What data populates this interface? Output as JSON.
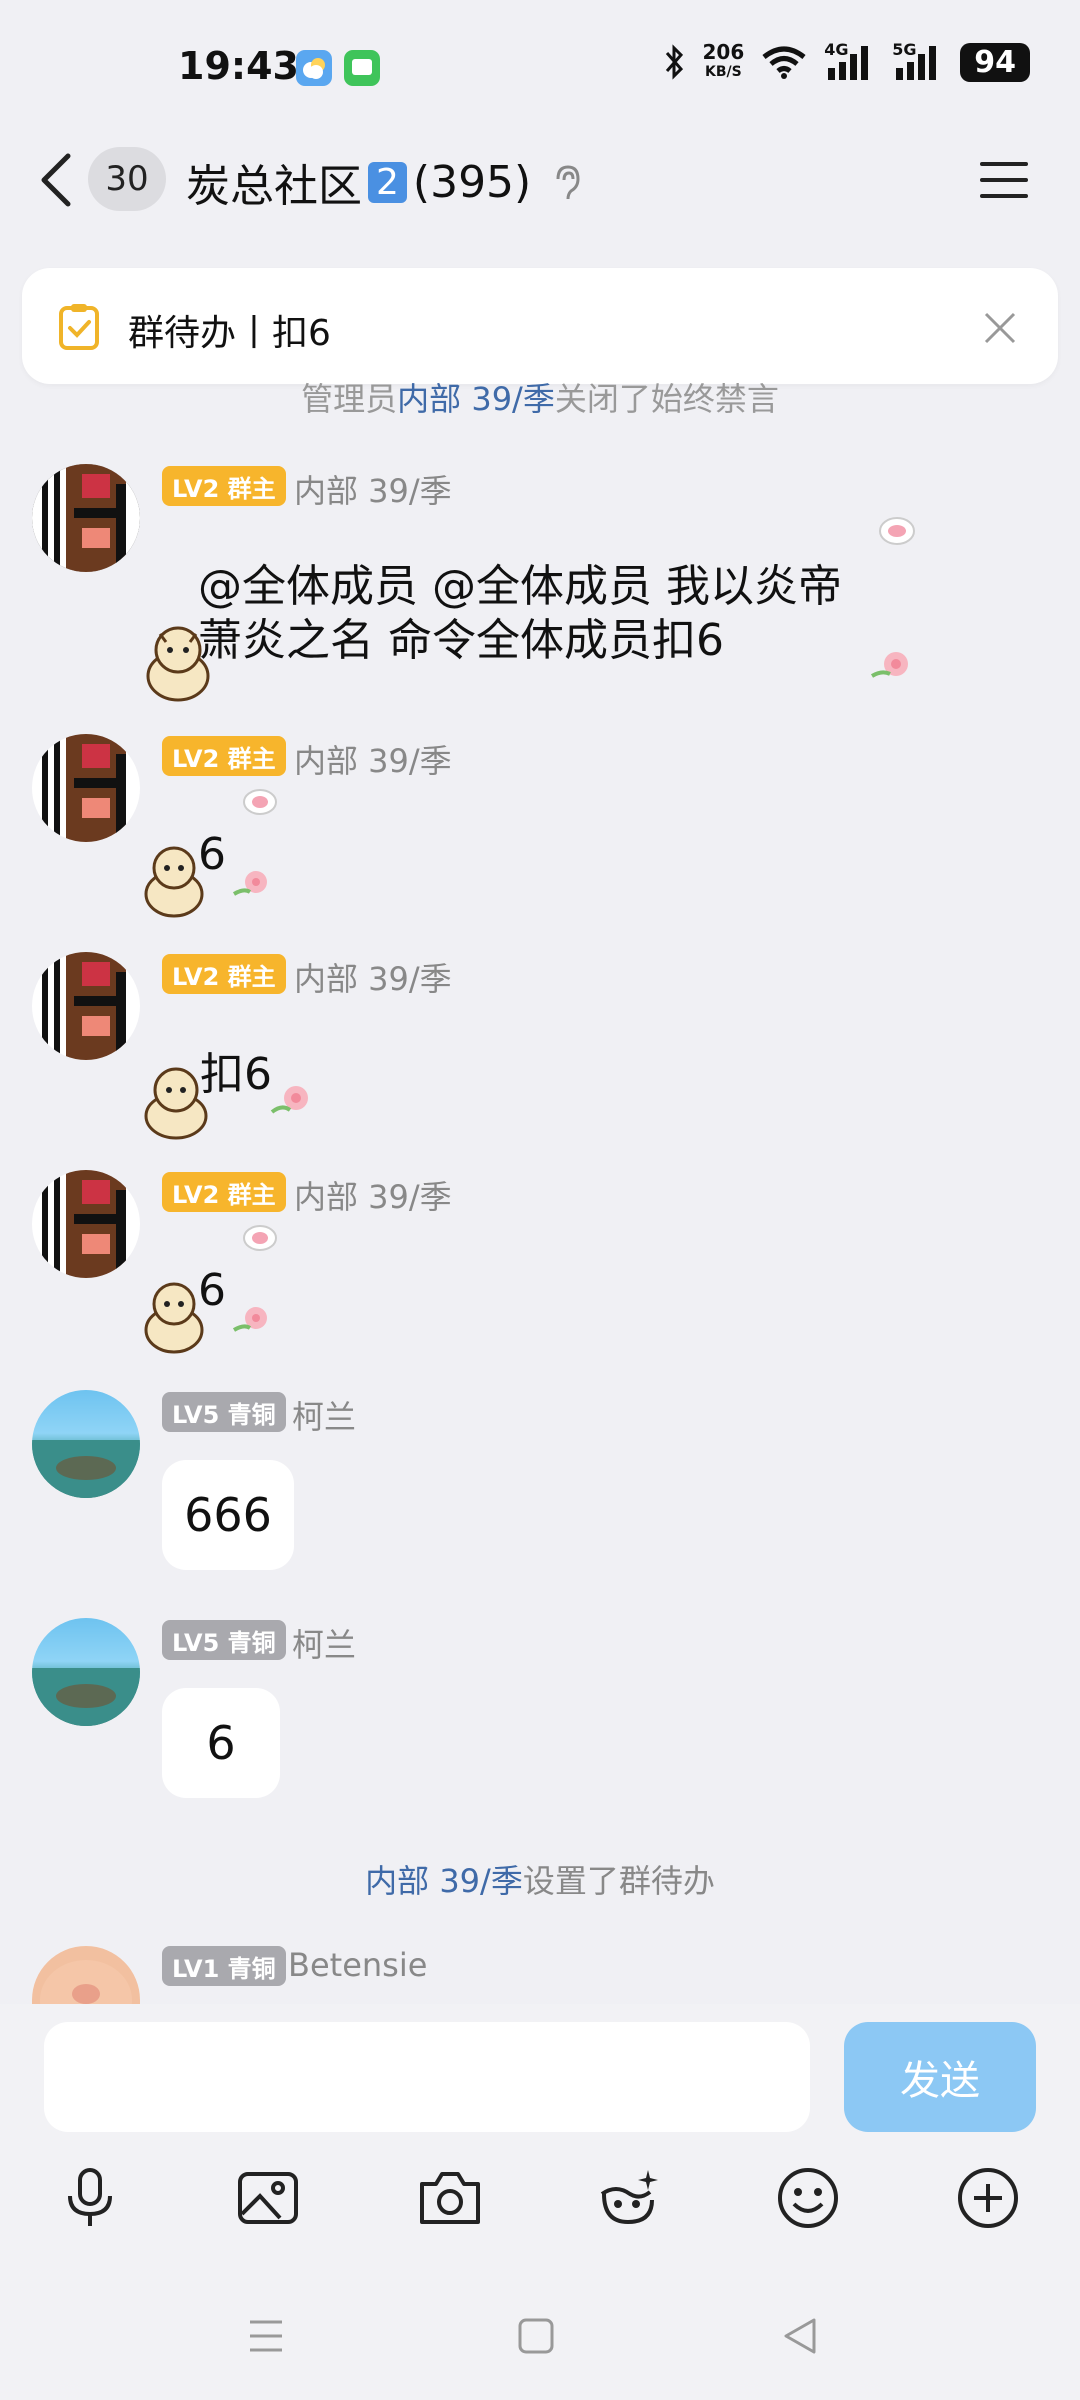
{
  "status_bar": {
    "time": "19:43",
    "net_speed_value": "206",
    "net_speed_unit": "KB/S",
    "signal_1": "4G",
    "signal_2": "5G",
    "battery": "94"
  },
  "header": {
    "unread_count": "30",
    "group_name": "炭总社区",
    "group_badge": "2",
    "member_count": "(395)"
  },
  "todo": {
    "text": "群待办丨扣6"
  },
  "system_top": {
    "prefix": "管理员",
    "user": "内部 39/季",
    "suffix": "关闭了始终禁言"
  },
  "messages": [
    {
      "level": "LV2 群主",
      "name": "内部 39/季",
      "text_line1": "@全体成员 @全体成员 我以炎帝",
      "text_line2": "萧炎之名 命令全体成员扣6"
    },
    {
      "level": "LV2 群主",
      "name": "内部 39/季",
      "text": "6"
    },
    {
      "level": "LV2 群主",
      "name": "内部 39/季",
      "text": "扣6"
    },
    {
      "level": "LV2 群主",
      "name": "内部 39/季",
      "text": "6"
    },
    {
      "level": "LV5 青铜",
      "name": "柯兰",
      "text": "666"
    },
    {
      "level": "LV5 青铜",
      "name": "柯兰",
      "text": "6"
    },
    {
      "level": "LV1 青铜",
      "name": "Betensie"
    }
  ],
  "system_bottom": {
    "user": "内部 39/季",
    "suffix": "设置了群待办"
  },
  "input": {
    "send_label": "发送"
  },
  "colors": {
    "accent_blue": "#3f6aa8",
    "send_button": "#8cc8f4",
    "gold_badge": "#f7b52c",
    "gray_badge": "#a9a9ae",
    "todo_icon": "#f0b429"
  }
}
